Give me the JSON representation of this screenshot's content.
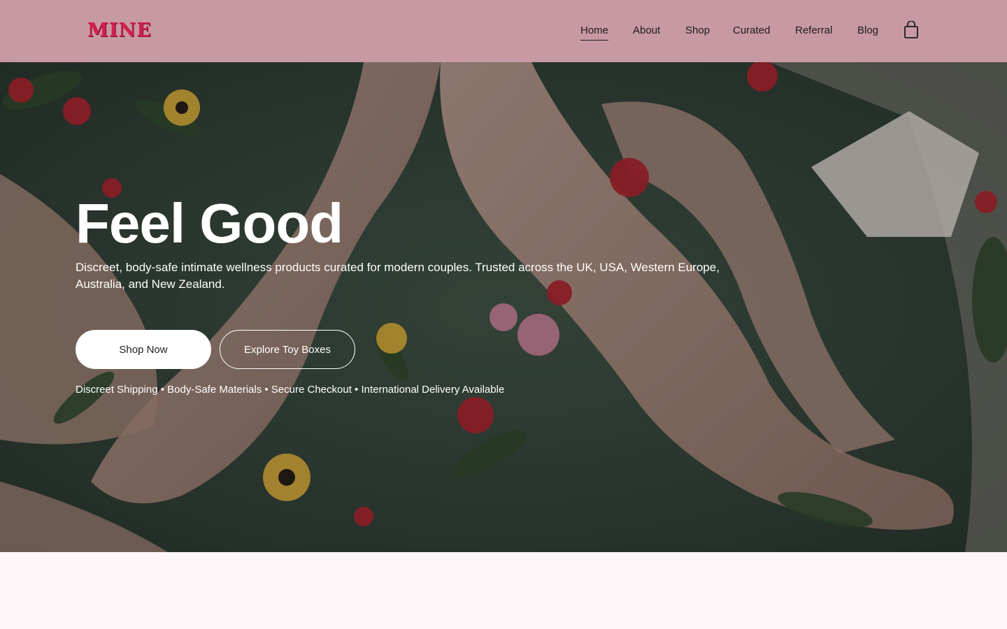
{
  "header": {
    "logo_text": "MINE",
    "nav": [
      {
        "label": "Home",
        "active": true
      },
      {
        "label": "About",
        "active": false
      },
      {
        "label": "Shop",
        "active": false
      },
      {
        "label": "Curated",
        "active": false
      },
      {
        "label": "Referral",
        "active": false
      },
      {
        "label": "Blog",
        "active": false
      }
    ],
    "cart_icon": "shopping-bag-icon"
  },
  "hero": {
    "title": "Feel Good",
    "subtitle": "Discreet, body-safe intimate wellness products curated for modern couples. Trusted across the UK, USA, Western Europe, Australia, and New Zealand.",
    "primary_button": "Shop Now",
    "secondary_button": "Explore Toy Boxes",
    "trust_line": "Discreet Shipping • Body-Safe Materials • Secure Checkout • International Delivery Available"
  },
  "colors": {
    "header_bg": "#c79aa3",
    "logo": "#d41f4f",
    "page_bg": "#fdf6f8"
  }
}
